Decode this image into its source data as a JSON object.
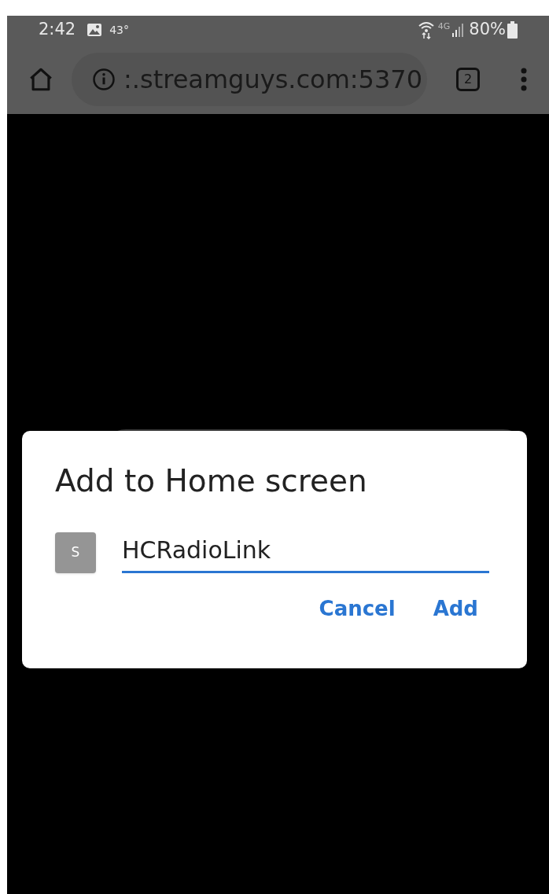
{
  "status_bar": {
    "time": "2:42",
    "temperature": "43°",
    "network": "4G",
    "battery": "80%"
  },
  "browser_bar": {
    "url": ":.streamguys.com:5370",
    "tab_count": "2"
  },
  "dialog": {
    "title": "Add to Home screen",
    "icon_letter": "S",
    "name_value": "HCRadioLink",
    "buttons": [
      "Cancel",
      "Add"
    ]
  }
}
